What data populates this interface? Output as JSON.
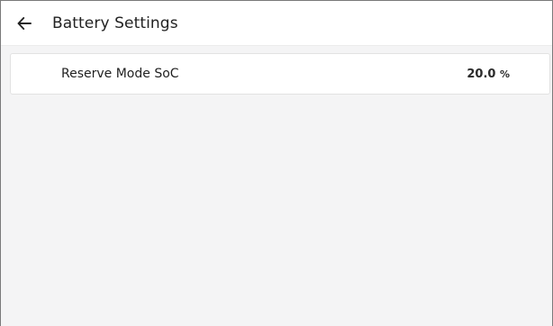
{
  "header": {
    "back_icon": "arrow-left-icon",
    "title": "Battery Settings"
  },
  "settings": {
    "items": [
      {
        "label": "Reserve Mode SoC",
        "value": "20.0",
        "unit": "%"
      }
    ]
  }
}
